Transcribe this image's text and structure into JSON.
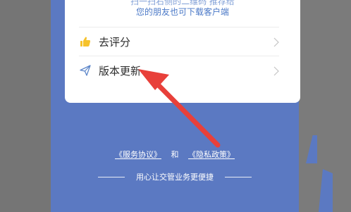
{
  "share": {
    "line_top": "扫一扫右侧的二维码 推荐给",
    "line_bottom": "您的朋友也可下载客户端"
  },
  "menu": {
    "items": [
      {
        "label": "去评分",
        "icon": "thumbs-up-icon"
      },
      {
        "label": "版本更新",
        "icon": "send-icon"
      }
    ]
  },
  "footer": {
    "service_agreement": "《服务协议》",
    "and_text": "和",
    "privacy_policy": "《隐私政策》",
    "slogan": "用心让交管业务更便捷"
  },
  "colors": {
    "panel_blue": "#5b79c2",
    "card_white": "#ffffff",
    "link_blue": "#4a78c7",
    "thumb_yellow": "#f6c22b",
    "send_blue": "#5c86c9",
    "annotation_red": "#e8403a"
  }
}
